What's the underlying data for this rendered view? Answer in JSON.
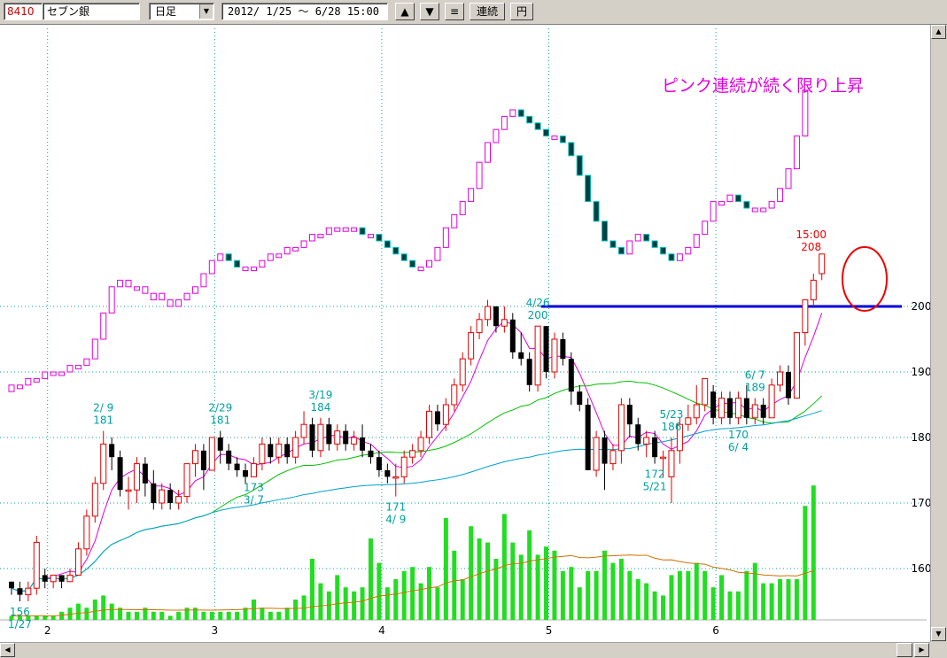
{
  "toolbar": {
    "stock_code": "8410",
    "stock_name": "セブン銀",
    "period": "日足",
    "date_range": "2012/ 1/25 ～  6/28 15:00",
    "btn_up": "▲",
    "btn_down": "▼",
    "btn_menu": "≡",
    "btn_continuous": "連続",
    "btn_yen": "円"
  },
  "colors": {
    "up_candle": "#e00000",
    "down_candle": "#000000",
    "ma_short": "#e000e0",
    "ma_mid": "#00c000",
    "ma_long": "#00a0d0",
    "volume": "#22dd22",
    "volume_ma": "#d07000",
    "pnf_up": "#e000e0",
    "pnf_down": "#004040",
    "pnf_down_accent": "#00c0c0",
    "resistance": "#0000dd",
    "annotation": "#e000e0",
    "price_label": "#00a0a0",
    "circle": "#ee0000",
    "grid": "#00a0a0"
  },
  "annotation": "ピンク連続が続く限り上昇",
  "chart_data": {
    "type": "candlestick",
    "ylim": [
      151,
      226
    ],
    "y_ticks": [
      160,
      170,
      180,
      190,
      200
    ],
    "month_labels": [
      {
        "label": "2",
        "index": 4
      },
      {
        "label": "3",
        "index": 24
      },
      {
        "label": "4",
        "index": 44
      },
      {
        "label": "5",
        "index": 64
      },
      {
        "label": "6",
        "index": 84
      }
    ],
    "resistance": {
      "start": 64,
      "value": 200
    },
    "candles": [
      [
        158,
        157,
        158,
        156
      ],
      [
        157,
        156,
        158,
        155
      ],
      [
        156,
        157,
        158,
        155
      ],
      [
        157,
        164,
        165,
        156
      ],
      [
        159,
        158,
        160,
        157
      ],
      [
        158,
        159,
        159,
        157
      ],
      [
        159,
        158,
        159,
        157
      ],
      [
        158,
        159,
        160,
        158
      ],
      [
        159,
        163,
        164,
        159
      ],
      [
        163,
        168,
        169,
        162
      ],
      [
        168,
        173,
        174,
        167
      ],
      [
        173,
        179,
        181,
        172
      ],
      [
        179,
        177,
        180,
        175
      ],
      [
        177,
        172,
        178,
        171
      ],
      [
        172,
        172,
        174,
        169
      ],
      [
        172,
        176,
        177,
        170
      ],
      [
        176,
        173,
        177,
        171
      ],
      [
        173,
        170,
        175,
        169
      ],
      [
        170,
        172,
        173,
        169
      ],
      [
        172,
        170,
        173,
        169
      ],
      [
        170,
        171,
        172,
        169
      ],
      [
        171,
        176,
        176,
        170
      ],
      [
        176,
        178,
        179,
        174
      ],
      [
        178,
        175,
        179,
        172
      ],
      [
        175,
        180,
        180,
        175
      ],
      [
        180,
        178,
        181,
        176
      ],
      [
        178,
        176,
        179,
        175
      ],
      [
        176,
        175,
        177,
        174
      ],
      [
        175,
        174,
        176,
        173
      ],
      [
        174,
        176,
        177,
        174
      ],
      [
        176,
        179,
        180,
        175
      ],
      [
        179,
        177,
        180,
        176
      ],
      [
        177,
        179,
        180,
        176
      ],
      [
        179,
        177,
        180,
        176
      ],
      [
        177,
        180,
        181,
        176
      ],
      [
        180,
        182,
        184,
        179
      ],
      [
        182,
        178,
        183,
        177
      ],
      [
        178,
        182,
        183,
        177
      ],
      [
        182,
        179,
        183,
        178
      ],
      [
        179,
        181,
        182,
        178
      ],
      [
        181,
        179,
        182,
        178
      ],
      [
        179,
        180,
        181,
        178
      ],
      [
        180,
        178,
        182,
        177
      ],
      [
        178,
        177,
        179,
        176
      ],
      [
        177,
        175,
        178,
        174
      ],
      [
        175,
        174,
        176,
        173
      ],
      [
        174,
        174,
        176,
        171
      ],
      [
        174,
        177,
        178,
        173
      ],
      [
        177,
        178,
        179,
        176
      ],
      [
        178,
        180,
        181,
        177
      ],
      [
        180,
        184,
        185,
        179
      ],
      [
        184,
        182,
        185,
        181
      ],
      [
        182,
        185,
        186,
        181
      ],
      [
        185,
        188,
        189,
        184
      ],
      [
        188,
        192,
        193,
        187
      ],
      [
        192,
        196,
        197,
        191
      ],
      [
        196,
        198,
        199,
        195
      ],
      [
        198,
        200,
        201,
        197
      ],
      [
        200,
        197,
        200,
        196
      ],
      [
        197,
        198,
        200,
        196
      ],
      [
        198,
        193,
        199,
        192
      ],
      [
        193,
        192,
        196,
        191
      ],
      [
        192,
        188,
        193,
        187
      ],
      [
        188,
        197,
        197,
        187
      ],
      [
        197,
        190,
        197,
        189
      ],
      [
        190,
        195,
        196,
        189
      ],
      [
        195,
        192,
        196,
        191
      ],
      [
        192,
        187,
        193,
        185
      ],
      [
        187,
        185,
        188,
        184
      ],
      [
        185,
        175,
        186,
        175
      ],
      [
        175,
        180,
        181,
        174
      ],
      [
        180,
        176,
        181,
        172
      ],
      [
        176,
        178,
        179,
        175
      ],
      [
        178,
        185,
        186,
        176
      ],
      [
        185,
        182,
        186,
        180
      ],
      [
        182,
        179,
        183,
        178
      ],
      [
        179,
        180,
        181,
        177
      ],
      [
        180,
        177,
        181,
        176
      ],
      [
        177,
        177,
        178,
        174
      ],
      [
        174,
        178,
        180,
        170
      ],
      [
        178,
        182,
        183,
        176
      ],
      [
        182,
        183,
        185,
        181
      ],
      [
        183,
        185,
        188,
        182
      ],
      [
        185,
        189,
        189,
        184
      ],
      [
        187,
        183,
        188,
        182
      ],
      [
        183,
        186,
        187,
        182
      ],
      [
        186,
        183,
        187,
        182
      ],
      [
        183,
        186,
        187,
        182
      ],
      [
        186,
        183,
        188,
        182
      ],
      [
        183,
        185,
        186,
        182
      ],
      [
        185,
        183,
        186,
        182
      ],
      [
        183,
        188,
        189,
        183
      ],
      [
        188,
        190,
        191,
        187
      ],
      [
        190,
        186,
        191,
        185
      ],
      [
        186,
        196,
        196,
        186
      ],
      [
        196,
        201,
        201,
        194
      ],
      [
        201,
        204,
        205,
        200
      ],
      [
        205,
        208,
        208,
        204
      ]
    ],
    "volumes": [
      1,
      1,
      1,
      1,
      1,
      1,
      2,
      3,
      4,
      3,
      5,
      6,
      4,
      3,
      2,
      2,
      3,
      2,
      2,
      1,
      2,
      3,
      3,
      2,
      2,
      2,
      2,
      2,
      3,
      5,
      3,
      2,
      2,
      3,
      5,
      6,
      15,
      9,
      7,
      11,
      8,
      7,
      8,
      20,
      14,
      8,
      10,
      12,
      13,
      9,
      13,
      8,
      25,
      17,
      10,
      23,
      20,
      19,
      15,
      26,
      19,
      16,
      22,
      16,
      18,
      17,
      12,
      13,
      8,
      12,
      12,
      17,
      14,
      15,
      12,
      10,
      9,
      7,
      6,
      11,
      12,
      12,
      14,
      12,
      8,
      11,
      7,
      7,
      12,
      14,
      9,
      9,
      10,
      10,
      10,
      28,
      33
    ],
    "pnf_bars": [
      [
        187,
        188
      ],
      [
        188,
        188
      ],
      [
        188,
        189
      ],
      [
        189,
        189
      ],
      [
        189,
        190
      ],
      [
        190,
        190
      ],
      [
        190,
        190
      ],
      [
        190,
        191
      ],
      [
        191,
        191
      ],
      [
        191,
        192
      ],
      [
        192,
        195
      ],
      [
        195,
        199
      ],
      [
        199,
        203
      ],
      [
        203,
        204
      ],
      [
        203,
        204
      ],
      [
        203,
        203
      ],
      [
        202,
        203
      ],
      [
        201,
        202
      ],
      [
        201,
        202
      ],
      [
        200,
        201
      ],
      [
        200,
        201
      ],
      [
        201,
        202
      ],
      [
        202,
        203
      ],
      [
        203,
        205
      ],
      [
        205,
        207
      ],
      [
        207,
        208
      ],
      [
        208,
        207
      ],
      [
        207,
        206
      ],
      [
        206,
        206
      ],
      [
        206,
        206
      ],
      [
        206,
        207
      ],
      [
        207,
        208
      ],
      [
        208,
        208
      ],
      [
        208,
        209
      ],
      [
        209,
        209
      ],
      [
        209,
        210
      ],
      [
        210,
        211
      ],
      [
        211,
        211
      ],
      [
        211,
        212
      ],
      [
        212,
        212
      ],
      [
        212,
        212
      ],
      [
        212,
        212
      ],
      [
        212,
        211
      ],
      [
        211,
        211
      ],
      [
        211,
        210
      ],
      [
        210,
        209
      ],
      [
        209,
        208
      ],
      [
        208,
        207
      ],
      [
        207,
        206
      ],
      [
        206,
        206
      ],
      [
        206,
        207
      ],
      [
        207,
        209
      ],
      [
        209,
        212
      ],
      [
        212,
        214
      ],
      [
        214,
        216
      ],
      [
        216,
        218
      ],
      [
        218,
        222
      ],
      [
        222,
        225
      ],
      [
        225,
        227
      ],
      [
        227,
        229
      ],
      [
        229,
        230
      ],
      [
        230,
        229
      ],
      [
        229,
        228
      ],
      [
        228,
        227
      ],
      [
        227,
        226
      ],
      [
        226,
        226
      ],
      [
        226,
        225
      ],
      [
        225,
        223
      ],
      [
        223,
        220
      ],
      [
        220,
        216
      ],
      [
        216,
        213
      ],
      [
        213,
        210
      ],
      [
        210,
        209
      ],
      [
        209,
        208
      ],
      [
        208,
        210
      ],
      [
        210,
        211
      ],
      [
        211,
        210
      ],
      [
        210,
        209
      ],
      [
        209,
        208
      ],
      [
        208,
        207
      ],
      [
        207,
        208
      ],
      [
        208,
        209
      ],
      [
        209,
        211
      ],
      [
        211,
        213
      ],
      [
        213,
        216
      ],
      [
        216,
        216
      ],
      [
        216,
        217
      ],
      [
        217,
        216
      ],
      [
        216,
        215
      ],
      [
        215,
        215
      ],
      [
        215,
        215
      ],
      [
        215,
        216
      ],
      [
        216,
        218
      ],
      [
        218,
        221
      ],
      [
        221,
        226
      ],
      [
        226,
        233
      ]
    ],
    "price_labels": [
      {
        "date": "1/27",
        "price": "156",
        "index": 1,
        "pos": "below"
      },
      {
        "date": "2/ 9",
        "price": "181",
        "index": 11,
        "pos": "above"
      },
      {
        "date": "2/29",
        "price": "181",
        "index": 25,
        "pos": "above"
      },
      {
        "date": "3/ 7",
        "price": "173",
        "index": 29,
        "pos": "below"
      },
      {
        "date": "3/19",
        "price": "184",
        "index": 37,
        "pos": "above"
      },
      {
        "date": "4/ 9",
        "price": "171",
        "index": 46,
        "pos": "below"
      },
      {
        "date": "4/26",
        "price": "200",
        "index": 63,
        "pos": "above"
      },
      {
        "date": "5/21",
        "price": "172",
        "index": 77,
        "pos": "below"
      },
      {
        "date": "5/23",
        "price": "186",
        "index": 79,
        "pos": "above"
      },
      {
        "date": "6/ 4",
        "price": "170",
        "index": 87,
        "pos": "below"
      },
      {
        "date": "6/ 7",
        "price": "189",
        "index": 89,
        "pos": "above"
      }
    ],
    "last": {
      "time": "15:00",
      "price": "208"
    }
  }
}
